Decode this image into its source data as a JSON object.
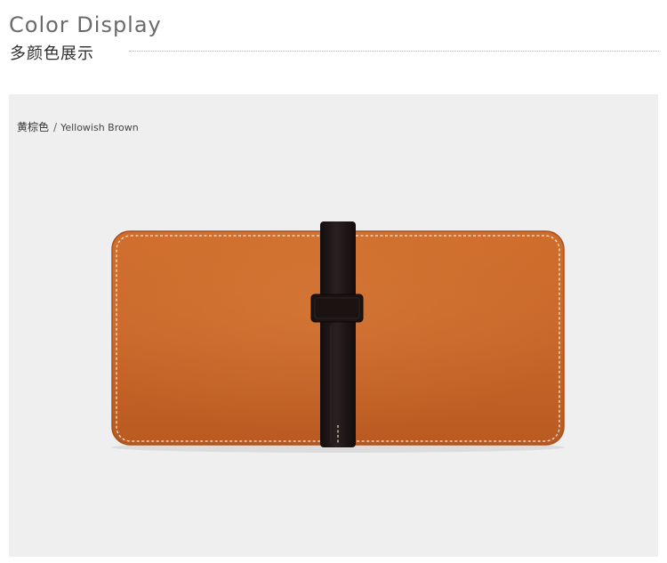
{
  "header": {
    "title_en": "Color Display",
    "title_cn": "多颜色展示"
  },
  "product": {
    "color_cn": "黄棕色",
    "separator": "/",
    "color_en": "Yellowish Brown",
    "leather_color": "#c8672a",
    "strap_color": "#1e1616",
    "background_color": "#efefef"
  }
}
